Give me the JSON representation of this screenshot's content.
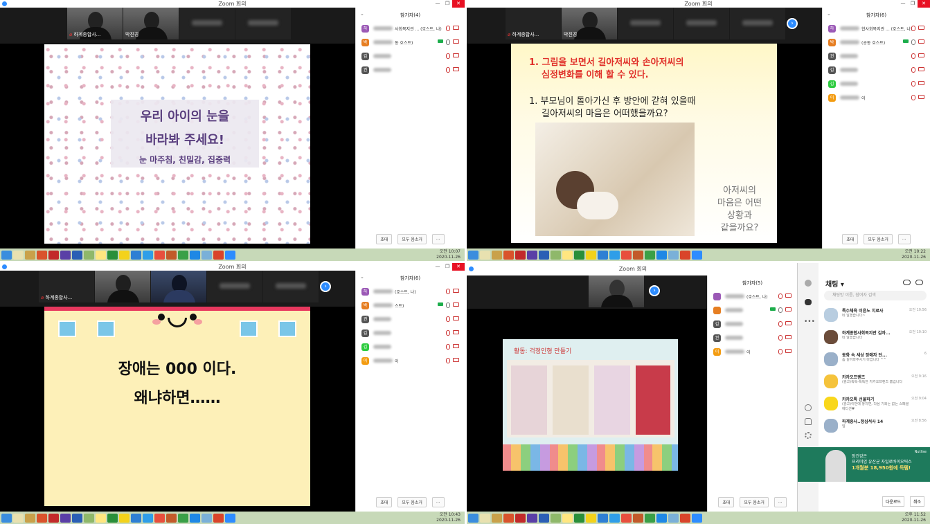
{
  "window_title": "Zoom 회의",
  "window_controls": [
    "—",
    "❐",
    "✕"
  ],
  "q1": {
    "thumbs": [
      {
        "name": "하계종합사..."
      },
      {
        "name": "박진경"
      }
    ],
    "slide": {
      "title_line1": "우리 아이의 눈을",
      "title_line2": "바라봐 주세요!",
      "subtitle": "눈 마주침, 친밀감, 집중력"
    },
    "panel": {
      "header": "참가자(4)",
      "rows": [
        {
          "initial": "하",
          "color": "#9b59b6",
          "suffix": "사회복지관 ... (호스트, 나)",
          "video": "off"
        },
        {
          "initial": "박",
          "color": "#e67e22",
          "suffix": "동 호스트)",
          "video": "on"
        },
        {
          "initial": "김",
          "color": "#555",
          "suffix": "",
          "video": "off"
        },
        {
          "initial": "권",
          "color": "#555",
          "suffix": "",
          "video": "off"
        }
      ],
      "invite": "초대",
      "mute_all": "모두 음소거",
      "more": "..."
    },
    "clock": {
      "time": "오전 10:07",
      "date": "2020-11-26"
    }
  },
  "q2": {
    "thumbs": [
      {
        "name": "하계종합사..."
      },
      {
        "name": "박진경"
      }
    ],
    "slide": {
      "heading_line1": "1. 그림을   보면서   길아저씨와 손아저씨의",
      "heading_line2": "심정변화를 이해 할 수 있다.",
      "question_line1": "1.  부모님이 돌아가신 후 방안에 갇혀 있을때",
      "question_line2": "길아저씨의 마음은 어떠했을까요?",
      "side_line1": "아저씨의",
      "side_line2": "마음은 어떤",
      "side_line3": "상황과",
      "side_line4": "같을까요?"
    },
    "panel": {
      "header": "참가자(6)",
      "rows": [
        {
          "initial": "하",
          "color": "#9b59b6",
          "suffix": "합사회복지관 ... (호스트, 나)",
          "video": "off"
        },
        {
          "initial": "박",
          "color": "#e67e22",
          "suffix": "(공동 호스트)",
          "video": "on"
        },
        {
          "initial": "권",
          "color": "#555",
          "suffix": "",
          "video": "off"
        },
        {
          "initial": "김",
          "color": "#555",
          "suffix": "",
          "video": "off"
        },
        {
          "initial": "김",
          "color": "#2ecc40",
          "suffix": "",
          "video": "off"
        },
        {
          "initial": "이",
          "color": "#f39c12",
          "suffix": "이",
          "video": "off"
        }
      ],
      "invite": "초대",
      "mute_all": "모두 음소거",
      "more": "..."
    },
    "clock": {
      "time": "오전 10:22",
      "date": "2020-11-26"
    }
  },
  "q3": {
    "thumbs": [
      {
        "name": "하계종합사..."
      }
    ],
    "slide": {
      "line1": "장애는 000 이다.",
      "line2": "왜냐하면……"
    },
    "panel": {
      "header": "참가자(6)",
      "rows": [
        {
          "initial": "하",
          "color": "#9b59b6",
          "suffix": "(호스트, 나)",
          "video": "off"
        },
        {
          "initial": "박",
          "color": "#e67e22",
          "suffix": "스트)",
          "video": "on"
        },
        {
          "initial": "권",
          "color": "#555",
          "suffix": "",
          "video": "off"
        },
        {
          "initial": "김",
          "color": "#555",
          "suffix": "",
          "video": "off"
        },
        {
          "initial": "김",
          "color": "#2ecc40",
          "suffix": "",
          "video": "off"
        },
        {
          "initial": "이",
          "color": "#f39c12",
          "suffix": "이",
          "video": "off"
        }
      ],
      "invite": "초대",
      "mute_all": "모두 음소거",
      "more": "..."
    },
    "clock": {
      "time": "오전 10:43",
      "date": "2020-11-26"
    }
  },
  "q4": {
    "slide": {
      "caption": "활동: 걱정인형 만들기"
    },
    "panel": {
      "header": "참가자(5)",
      "rows": [
        {
          "initial": "",
          "color": "#9b59b6",
          "suffix": "(호스트, 나)",
          "video": "off"
        },
        {
          "initial": "",
          "color": "#e67e22",
          "suffix": "",
          "video": "on"
        },
        {
          "initial": "김",
          "color": "#555",
          "suffix": "",
          "video": "off"
        },
        {
          "initial": "권",
          "color": "#555",
          "suffix": "",
          "video": "off"
        },
        {
          "initial": "이",
          "color": "#f39c12",
          "suffix": "이",
          "video": "off"
        }
      ],
      "invite": "초대",
      "mute_all": "모두 음소거",
      "more": "..."
    },
    "chat": {
      "title": "채팅 ▾",
      "search_placeholder": "채팅방 이름, 참여자 검색",
      "items": [
        {
          "name": "특수체육 이윤노 치료사",
          "msg": "네 알겠습니다~",
          "time": "오전 10:56"
        },
        {
          "name": "하계종합사회복지관 김자...",
          "msg": "네 알겠습니다",
          "time": "오전 10:10"
        },
        {
          "name": "동화 속 세상 장애자 단...",
          "msg": "좀 들어와주시기 바랍니다 ^^",
          "time": "6"
        },
        {
          "name": "카카오프렌즈",
          "msg": "(광고)톡톡-톡톡한 카카오프렌즈 홈입니다",
          "time": "오전 9:16"
        },
        {
          "name": "카카오톡 선물하기",
          "msg": "(광고)이번에 놓치면, 다음 기회는 없는 스페셜 에디션♥",
          "time": "오전 9:04"
        },
        {
          "name": "하계종사..정심석사 14",
          "msg": "넵",
          "time": "오전 8:56"
        }
      ],
      "ad": {
        "brand": "Nutlise",
        "line1": "장건강은",
        "line2": "프리미엄 유산균 자일로바이오틱스",
        "line3": "1개월분 18,950원에 득템!"
      },
      "download": "다운로드",
      "cancel": "취소"
    },
    "clock": {
      "time": "오후 11:52",
      "date": "2020-11-26"
    }
  }
}
